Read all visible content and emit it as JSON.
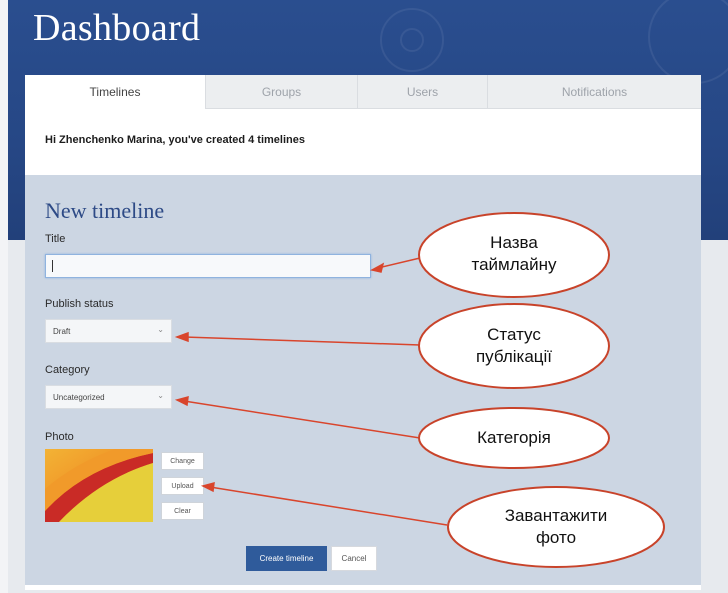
{
  "header": {
    "title": "Dashboard"
  },
  "tabs": [
    {
      "label": "Timelines",
      "active": true
    },
    {
      "label": "Groups",
      "active": false
    },
    {
      "label": "Users",
      "active": false
    },
    {
      "label": "Notifications",
      "active": false
    }
  ],
  "greeting": "Hi Zhenchenko Marina, you've created 4 timelines",
  "form": {
    "heading": "New timeline",
    "title_label": "Title",
    "title_value": "",
    "publish_label": "Publish status",
    "publish_value": "Draft",
    "category_label": "Category",
    "category_value": "Uncategorized",
    "photo_label": "Photo",
    "change_label": "Change",
    "upload_label": "Upload",
    "clear_label": "Clear",
    "create_label": "Create timeline",
    "cancel_label": "Cancel"
  },
  "annotations": {
    "title_line1": "Назва",
    "title_line2": "таймлайну",
    "status_line1": "Статус",
    "status_line2": "публікації",
    "category": "Категорія",
    "upload_line1": "Завантажити",
    "upload_line2": "фото"
  },
  "colors": {
    "header": "#264785",
    "form_bg": "#ccd6e3",
    "primary_button": "#2f5b9b",
    "arrow": "#d9452c"
  }
}
